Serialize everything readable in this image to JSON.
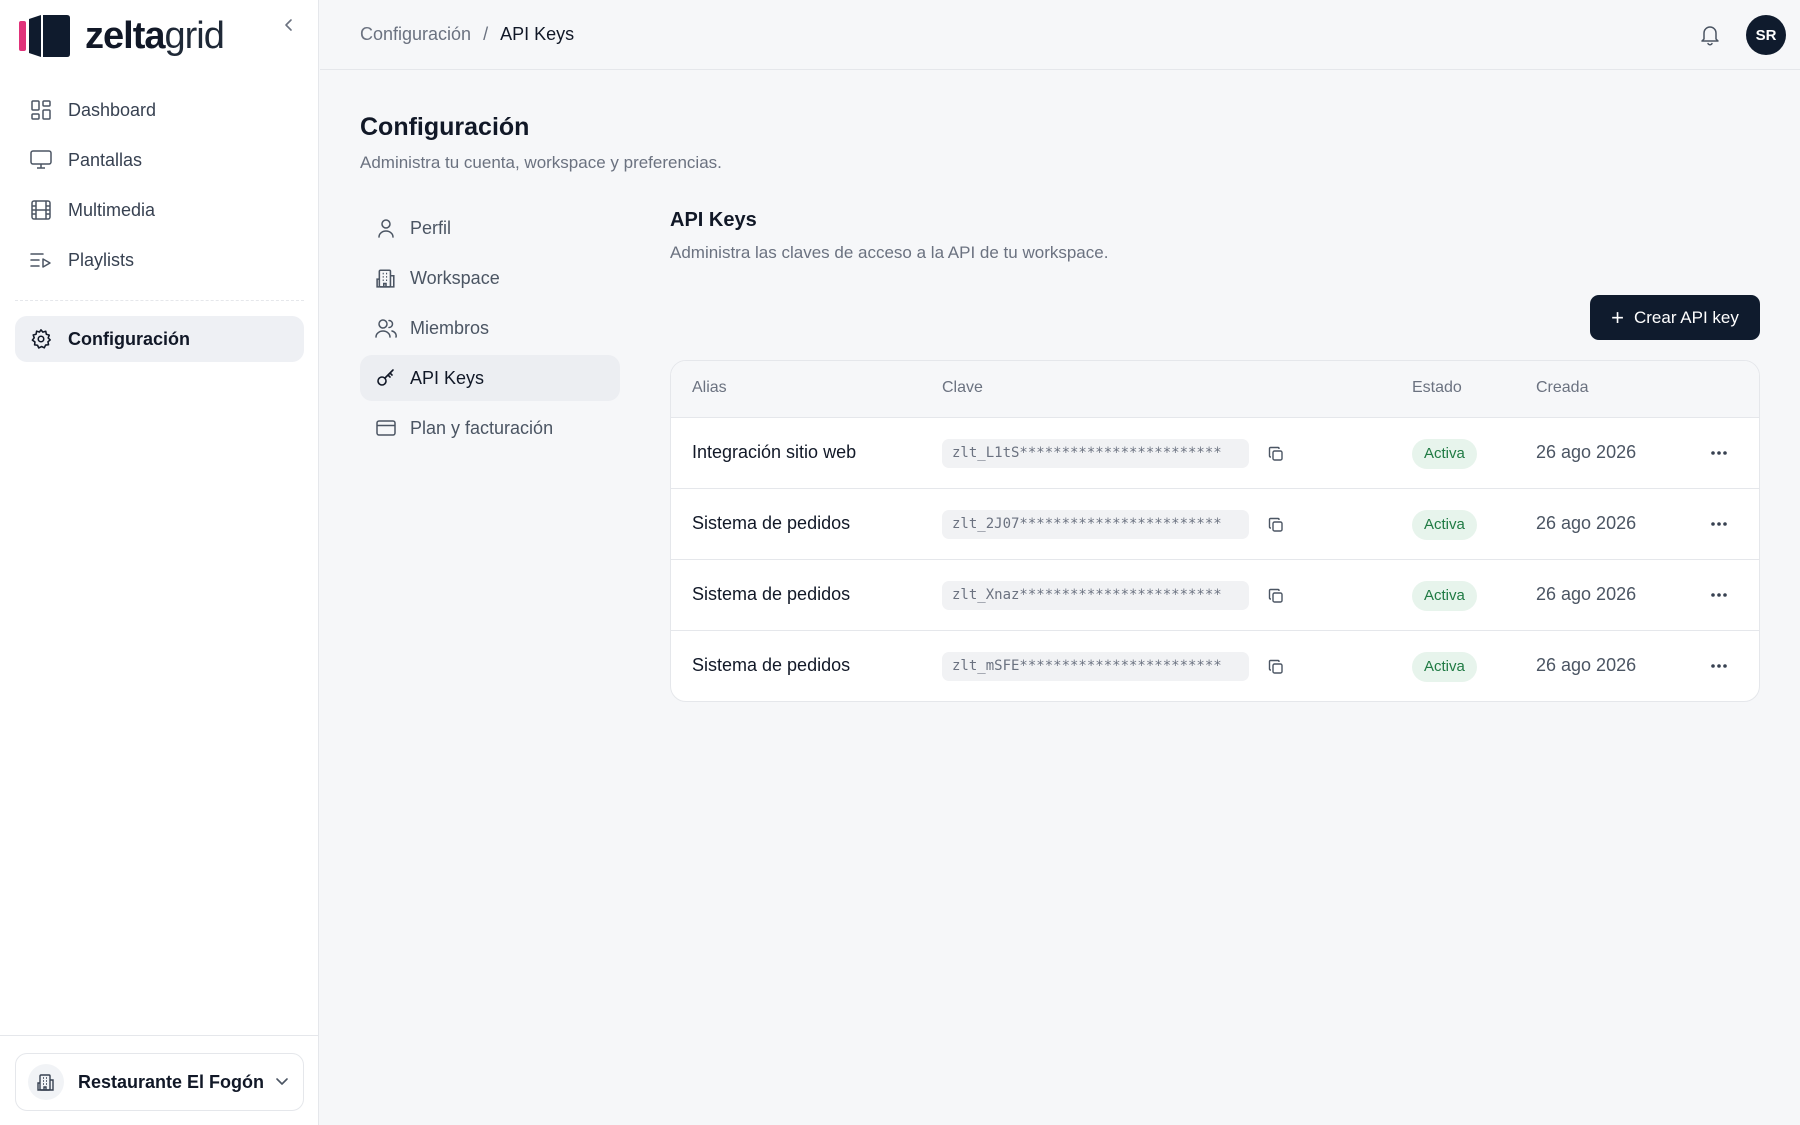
{
  "app": {
    "logo_bold": "zelta",
    "logo_light": "grid"
  },
  "sidebar": {
    "items": [
      {
        "label": "Dashboard",
        "icon": "dashboard-icon"
      },
      {
        "label": "Pantallas",
        "icon": "monitor-icon"
      },
      {
        "label": "Multimedia",
        "icon": "film-icon"
      },
      {
        "label": "Playlists",
        "icon": "playlist-icon"
      }
    ],
    "config_label": "Configuración",
    "workspace_name": "Restaurante El Fogón"
  },
  "topbar": {
    "breadcrumb": [
      "Configuración",
      "API Keys"
    ],
    "breadcrumb_sep": "/",
    "avatar_initials": "SR"
  },
  "page": {
    "title": "Configuración",
    "subtitle": "Administra tu cuenta, workspace y preferencias."
  },
  "settings_nav": [
    {
      "label": "Perfil",
      "icon": "user-icon"
    },
    {
      "label": "Workspace",
      "icon": "building-icon"
    },
    {
      "label": "Miembros",
      "icon": "users-icon"
    },
    {
      "label": "API Keys",
      "icon": "key-icon",
      "active": true
    },
    {
      "label": "Plan y facturación",
      "icon": "credit-card-icon"
    }
  ],
  "api_keys": {
    "title": "API Keys",
    "subtitle": "Administra las claves de acceso a la API de tu workspace.",
    "create_label": "Crear API key",
    "columns": {
      "alias": "Alias",
      "key": "Clave",
      "status": "Estado",
      "created": "Creada"
    },
    "rows": [
      {
        "alias": "Integración sitio web",
        "key": "zlt_L1tS************************",
        "status": "Activa",
        "created": "26 ago 2026"
      },
      {
        "alias": "Sistema de pedidos",
        "key": "zlt_2J07************************",
        "status": "Activa",
        "created": "26 ago 2026"
      },
      {
        "alias": "Sistema de pedidos",
        "key": "zlt_Xnaz************************",
        "status": "Activa",
        "created": "26 ago 2026"
      },
      {
        "alias": "Sistema de pedidos",
        "key": "zlt_mSFE************************",
        "status": "Activa",
        "created": "26 ago 2026"
      }
    ]
  },
  "colors": {
    "brand_dark": "#0f1b2d",
    "brand_pink": "#e0337a",
    "status_green": "#1f7a43"
  }
}
